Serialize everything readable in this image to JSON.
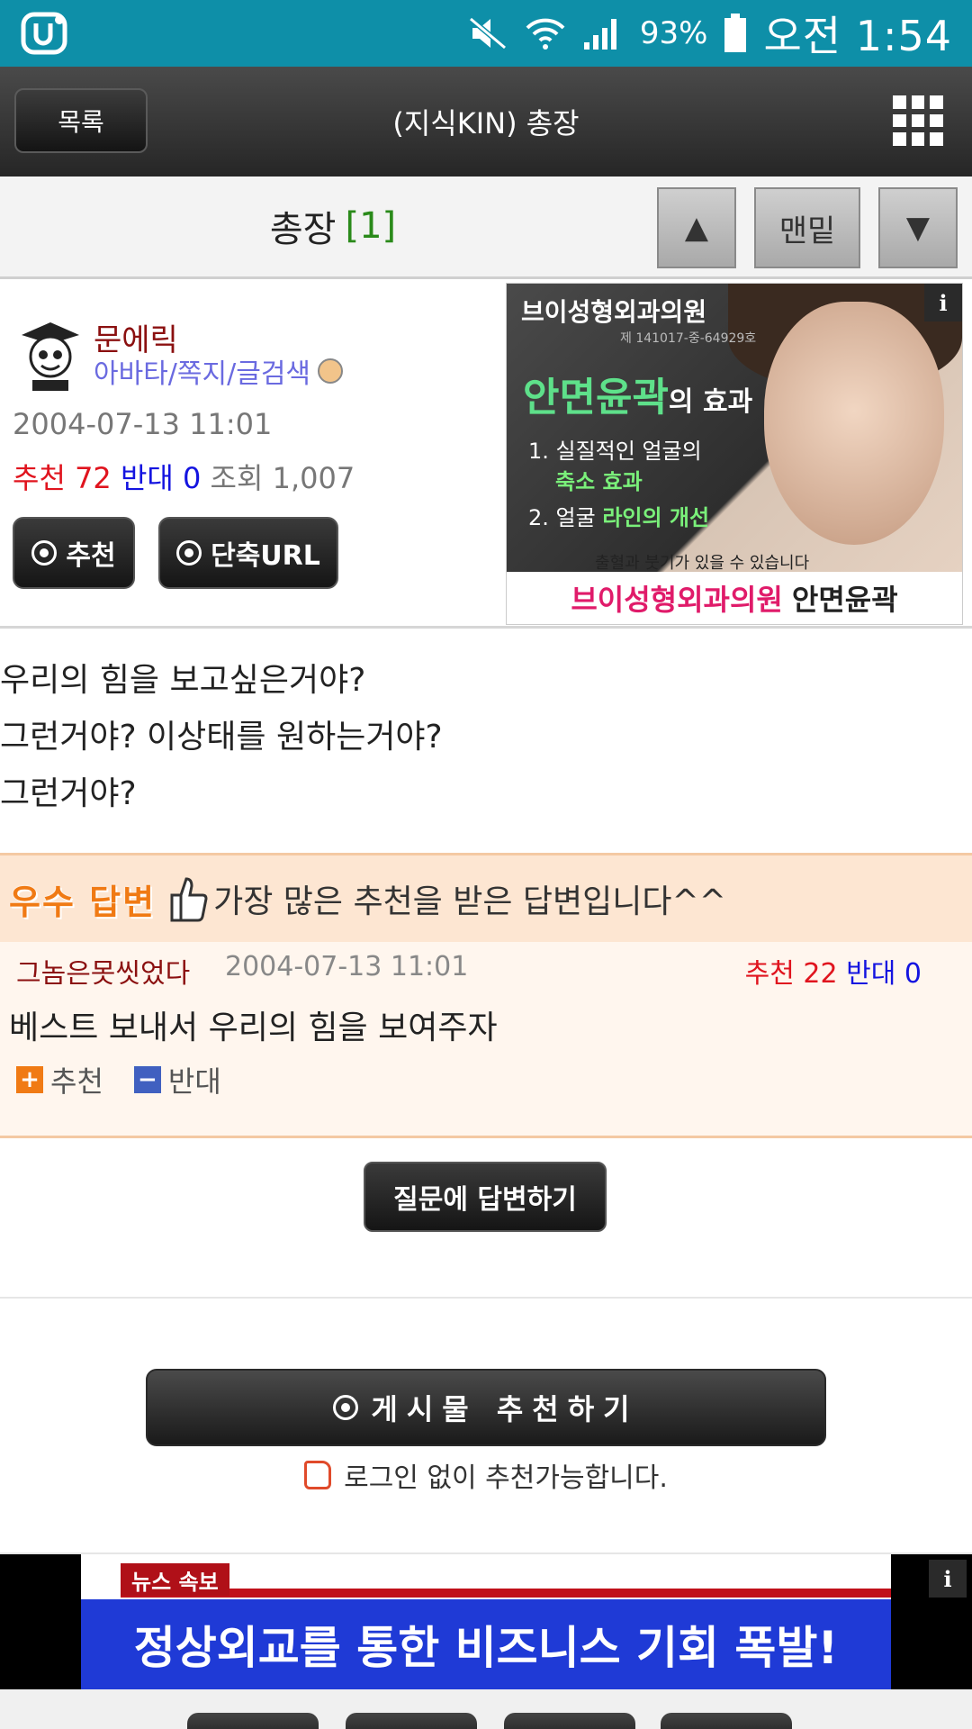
{
  "status": {
    "battery": "93%",
    "time": "오전 1:54"
  },
  "header": {
    "list_button": "목록",
    "title": "(지식KIN) 총장"
  },
  "nav": {
    "title": "총장",
    "count": "[1]",
    "up": "▲",
    "bottom": "맨밑",
    "down": "▼"
  },
  "post": {
    "author": "문에릭",
    "author_links": "아바타/쪽지/글검색",
    "date": "2004-07-13 11:01",
    "rec_label": "추천",
    "rec_value": "72",
    "opp_label": "반대",
    "opp_value": "0",
    "view_label": "조회",
    "view_value": "1,007",
    "rec_button": "추천",
    "url_button": "단축URL"
  },
  "ad_right": {
    "clinic": "브이성형외과의원",
    "reg": "제 141017-중-64929호",
    "headline": "안면윤곽",
    "headline_suffix": "의 효과",
    "line1": "1. 실질적인 얼굴의",
    "line1b": "축소 효과",
    "line2": "2. 얼굴",
    "line2b": "라인의 개선",
    "note": "출혈과 붓기가 있을 수 있습니다",
    "bottom_pink": "브이성형외과의원",
    "bottom_dark": "안면윤곽",
    "info": "i"
  },
  "question": {
    "lines": [
      "우리의 힘을 보고싶은거야?",
      "그런거야? 이상태를 원하는거야?",
      "그런거야?"
    ]
  },
  "best_answer": {
    "label": "우수 답변",
    "description": "가장 많은 추천을 받은 답변입니다^^",
    "author": "그놈은못씻었다",
    "date": "2004-07-13 11:01",
    "rec_label": "추천",
    "rec_value": "22",
    "opp_label": "반대",
    "opp_value": "0",
    "text": "베스트 보내서 우리의 힘을 보여주자",
    "plus_label": "추천",
    "minus_label": "반대"
  },
  "actions": {
    "answer_button": "질문에 답변하기",
    "recommend_button": "게시물 추천하기",
    "login_note": "로그인 없이 추천가능합니다."
  },
  "banner": {
    "tag": "뉴스 속보",
    "headline": "정상외교를 통한 비즈니스 기회 폭발!",
    "info": "i"
  },
  "colors": {
    "status_bar": "#0e8fa8",
    "accent_red": "#e0141e",
    "accent_blue": "#1414e0",
    "best_orange": "#f07a14"
  }
}
